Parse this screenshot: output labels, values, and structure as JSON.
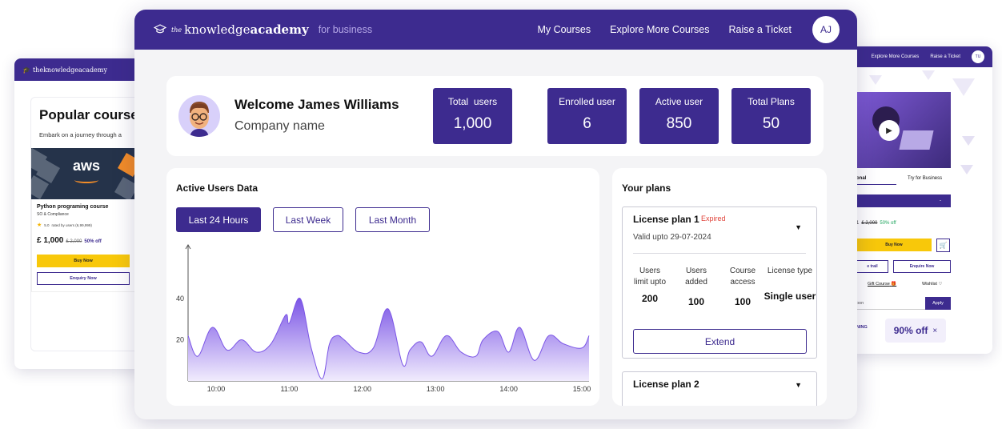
{
  "colors": {
    "brand": "#3d2b8f",
    "accent_yellow": "#f8c80a",
    "expired_red": "#e0433a",
    "discount_green": "#1aa35a"
  },
  "main": {
    "brand": {
      "the": "the",
      "knowledge": "knowledge",
      "academy": "academy",
      "suffix": "for business"
    },
    "nav": [
      "My Courses",
      "Explore More Courses",
      "Raise a Ticket"
    ],
    "avatar_initials": "AJ",
    "welcome": {
      "greeting": "Welcome James Williams",
      "company": "Company name"
    },
    "stats": [
      {
        "label": "Total  users",
        "value": "1,000"
      },
      {
        "label": "Enrolled user",
        "value": "6"
      },
      {
        "label": "Active user",
        "value": "850"
      },
      {
        "label": "Total Plans",
        "value": "50"
      }
    ],
    "active_users": {
      "title": "Active Users Data",
      "ranges": [
        "Last 24 Hours",
        "Last Week",
        "Last Month"
      ],
      "selected_range": "Last 24 Hours"
    },
    "plans": {
      "title": "Your plans",
      "plan1": {
        "name": "License plan 1",
        "status": "Expired",
        "valid": "Valid upto 29-07-2024",
        "columns": [
          {
            "label": "Users limit upto",
            "value": "200"
          },
          {
            "label": "Users added",
            "value": "100"
          },
          {
            "label": "Course access",
            "value": "100"
          },
          {
            "label": "License type",
            "value": "Single user"
          }
        ],
        "extend_label": "Extend"
      },
      "plan2": {
        "name": "License plan 2"
      }
    }
  },
  "chart_data": {
    "type": "area",
    "title": "",
    "xlabel": "",
    "ylabel": "",
    "x_ticks": [
      "10:00",
      "11:00",
      "12:00",
      "13:00",
      "14:00",
      "15:00"
    ],
    "y_ticks": [
      20,
      40
    ],
    "ylim": [
      0,
      66
    ],
    "x": [
      9.6,
      9.75,
      9.95,
      10.15,
      10.35,
      10.55,
      10.75,
      10.95,
      11.0,
      11.15,
      11.3,
      11.45,
      11.55,
      11.65,
      11.75,
      11.95,
      12.15,
      12.35,
      12.55,
      12.65,
      12.8,
      12.95,
      13.15,
      13.35,
      13.55,
      13.65,
      13.85,
      14.0,
      14.15,
      14.35,
      14.55,
      14.75,
      15.0,
      15.1
    ],
    "series": [
      {
        "values": [
          22,
          12,
          26,
          15,
          20,
          14,
          18,
          32,
          28,
          40,
          16,
          1,
          18,
          22,
          20,
          14,
          16,
          35,
          8,
          15,
          19,
          12,
          22,
          14,
          12,
          20,
          24,
          14,
          26,
          10,
          22,
          18,
          16,
          22
        ]
      }
    ]
  },
  "left_card": {
    "logo": "theknowledgeacademy",
    "title": "Popular course",
    "subtitle": "Embark on a journey through a",
    "thumb_text": "aws",
    "course_name": "Python programing course",
    "course_category": "SO & Compliance",
    "rating": "5.0",
    "rating_text": "rated by users (6,99,999)",
    "price": "£ 1,000",
    "old_price": "£ 2,000",
    "discount": "50% off",
    "buy_label": "Buy Now",
    "enquiry_label": "Enquiry Now"
  },
  "right_card": {
    "nav": [
      "Explore More Courses",
      "Raise a Ticket"
    ],
    "avatar_initials": "TU",
    "tabs": [
      "onal",
      "Try for Business"
    ],
    "select_caret": "-",
    "price_prefix": "1",
    "old_price": "£ 2,000",
    "discount": "50% off",
    "buy_label": "Buy Now",
    "free_trial_label": "e trail",
    "enquire_label": "Enquire Now",
    "gift_label": "Gift Course",
    "wishlist_label": "Wishlist",
    "coupon_placeholder": "pon",
    "apply_label": "Apply",
    "ending_label": "NING",
    "badge": "90% off",
    "badge_close": "×"
  }
}
